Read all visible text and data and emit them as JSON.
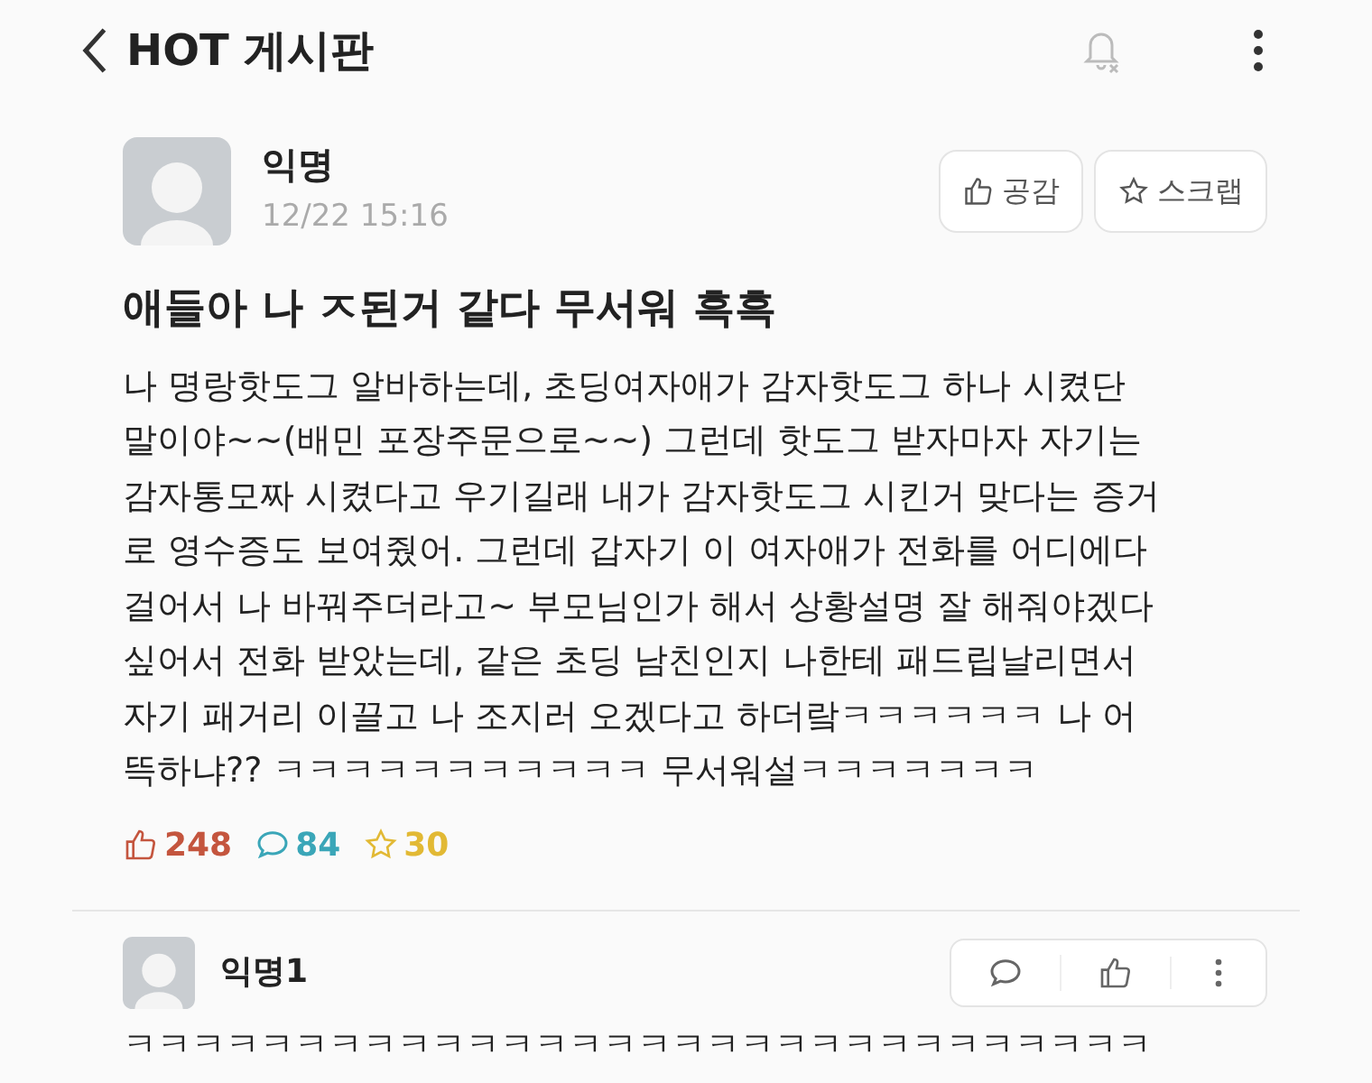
{
  "header": {
    "title": "HOT 게시판"
  },
  "post": {
    "author": "익명",
    "time": "12/22 15:16",
    "buttons": [
      "공감",
      "스크랩"
    ],
    "title": "애들아 나 ㅈ된거 같다 무서워 흑흑",
    "lines": [
      "나 명랑핫도그 알바하는데, 초딩여자애가 감자핫도그 하나 시켰단",
      "말이야~~(배민 포장주문으로~~) 그런데 핫도그 받자마자 자기는",
      "감자통모짜 시켰다고 우기길래 내가 감자핫도그 시킨거 맞다는 증거",
      "로 영수증도 보여줬어. 그런데 갑자기 이 여자애가 전화를 어디에다",
      "걸어서 나 바꿔주더라고~ 부모님인가 해서 상황설명 잘 해줘야겠다",
      "싶어서 전화 받았는데, 같은 초딩 남친인지 나한테 패드립날리면서",
      "자기 패거리 이끌고 나 조지러 오겠다고 하더랔ㅋㅋㅋㅋㅋㅋ 나 어",
      "뜩하냐?? ㅋㅋㅋㅋㅋㅋㅋㅋㅋㅋㅋ 무서워설ㅋㅋㅋㅋㅋㅋㅋ"
    ],
    "stats": [
      {
        "kind": "like",
        "count": "248"
      },
      {
        "kind": "comment",
        "count": "84"
      },
      {
        "kind": "scrap",
        "count": "30"
      }
    ]
  },
  "comments": [
    {
      "author": "익명1",
      "text": "ㅋㅋㅋㅋㅋㅋㅋㅋㅋㅋㅋㅋㅋㅋㅋㅋㅋㅋㅋㅋㅋㅋㅋㅋㅋㅋㅋㅋㅋㅋ"
    }
  ]
}
